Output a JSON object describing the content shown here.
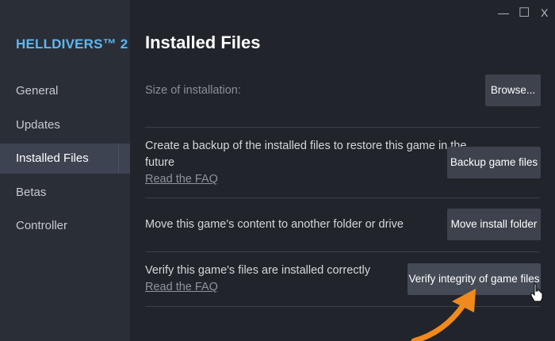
{
  "game_title": "HELLDIVERS™ 2",
  "sidebar": {
    "items": [
      {
        "label": "General",
        "active": false
      },
      {
        "label": "Updates",
        "active": false
      },
      {
        "label": "Installed Files",
        "active": true
      },
      {
        "label": "Betas",
        "active": false
      },
      {
        "label": "Controller",
        "active": false
      }
    ]
  },
  "main": {
    "title": "Installed Files",
    "size_label": "Size of installation:",
    "browse_button": "Browse...",
    "backup": {
      "text_line1": "Create a backup of the installed files to restore this game in the",
      "text_line2": "future",
      "faq": "Read the FAQ",
      "button": "Backup game files"
    },
    "move": {
      "text": "Move this game's content to another folder or drive",
      "button": "Move install folder"
    },
    "verify": {
      "text": "Verify this game's files are installed correctly",
      "faq": "Read the FAQ",
      "button": "Verify integrity of game files"
    }
  },
  "window_controls": {
    "minimize": "—",
    "maximize": "☐",
    "close": "X"
  },
  "colors": {
    "accent": "#5fb7f2",
    "annotation_arrow": "#f08a1c"
  }
}
